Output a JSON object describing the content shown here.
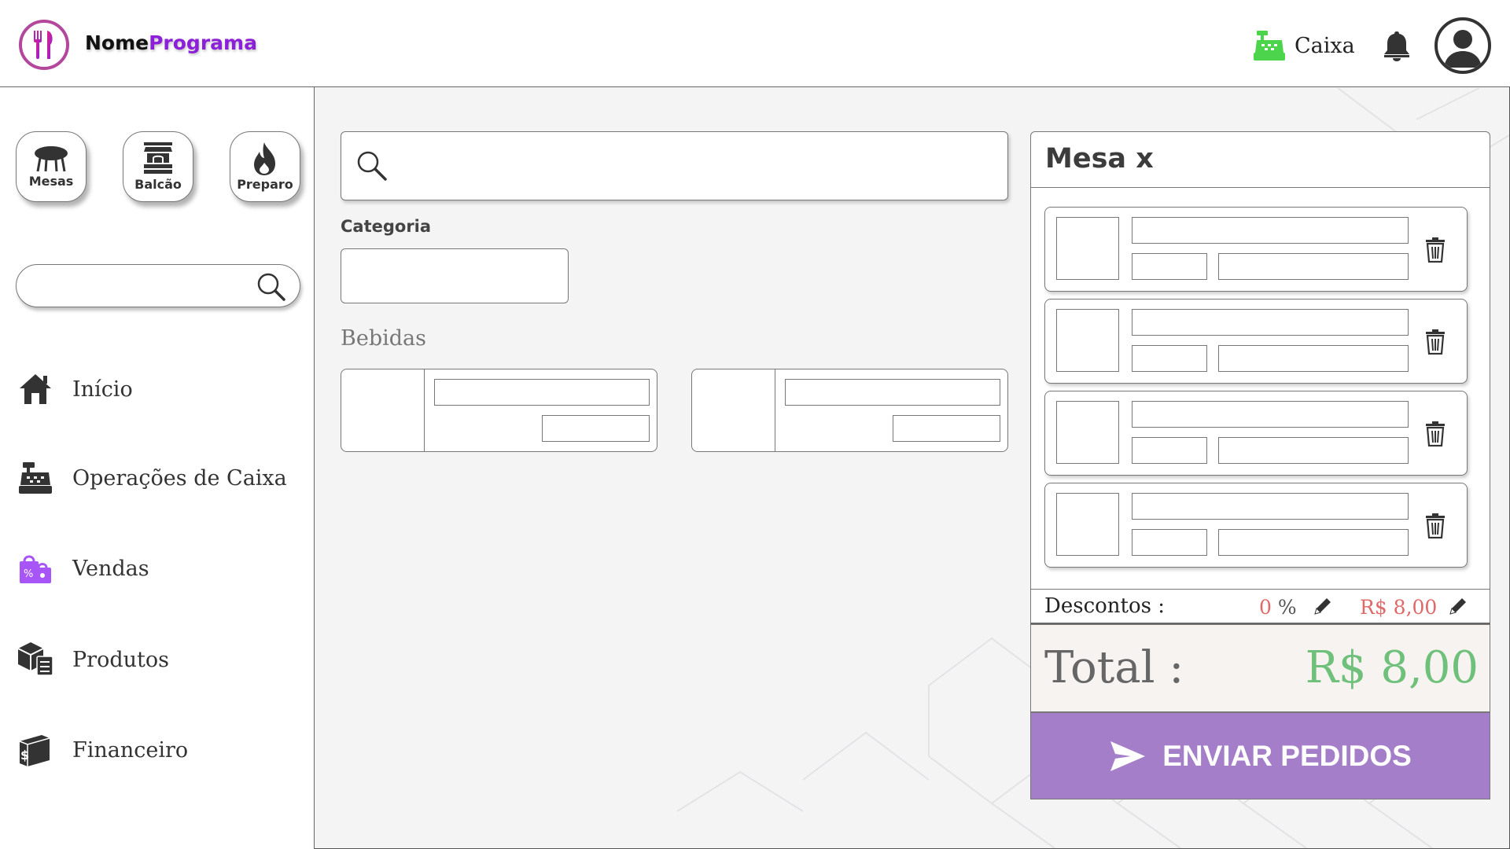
{
  "app": {
    "brand_part1": "Nome",
    "brand_part2": "Programa",
    "brand_color": "#8c1fd8",
    "logo_icon": "fork-knife-icon"
  },
  "header": {
    "caixa_label": "Caixa",
    "caixa_icon": "cash-register-icon",
    "caixa_icon_color": "#4cd44c",
    "bell_icon": "bell-icon",
    "avatar_icon": "user-avatar-icon"
  },
  "sidebar": {
    "quick_buttons": [
      {
        "label": "Mesas",
        "icon": "table-icon"
      },
      {
        "label": "Balcão",
        "icon": "counter-icon"
      },
      {
        "label": "Preparo",
        "icon": "fire-icon"
      }
    ],
    "search_icon": "search-icon",
    "nav": [
      {
        "label": "Início",
        "icon": "home-icon"
      },
      {
        "label": "Operações de Caixa",
        "icon": "cash-register-icon"
      },
      {
        "label": "Vendas",
        "icon": "shopping-bags-icon",
        "icon_color": "#a855f7"
      },
      {
        "label": "Produtos",
        "icon": "boxes-icon"
      },
      {
        "label": "Financeiro",
        "icon": "wallet-icon"
      }
    ]
  },
  "main": {
    "search_icon": "search-icon",
    "category_label": "Categoria",
    "section_title": "Bebidas"
  },
  "order": {
    "title": "Mesa x",
    "discount_label": "Descontos :",
    "discount_percent": "0",
    "percent_sign": "%",
    "discount_amount": "R$ 8,00",
    "discount_color": "#e06868",
    "total_label": "Total :",
    "total_value": "R$ 8,00",
    "total_color": "#6fc07b",
    "send_label": "ENVIAR PEDIDOS",
    "send_color": "#a47ec8",
    "item_action_icon": "trash-icon"
  }
}
